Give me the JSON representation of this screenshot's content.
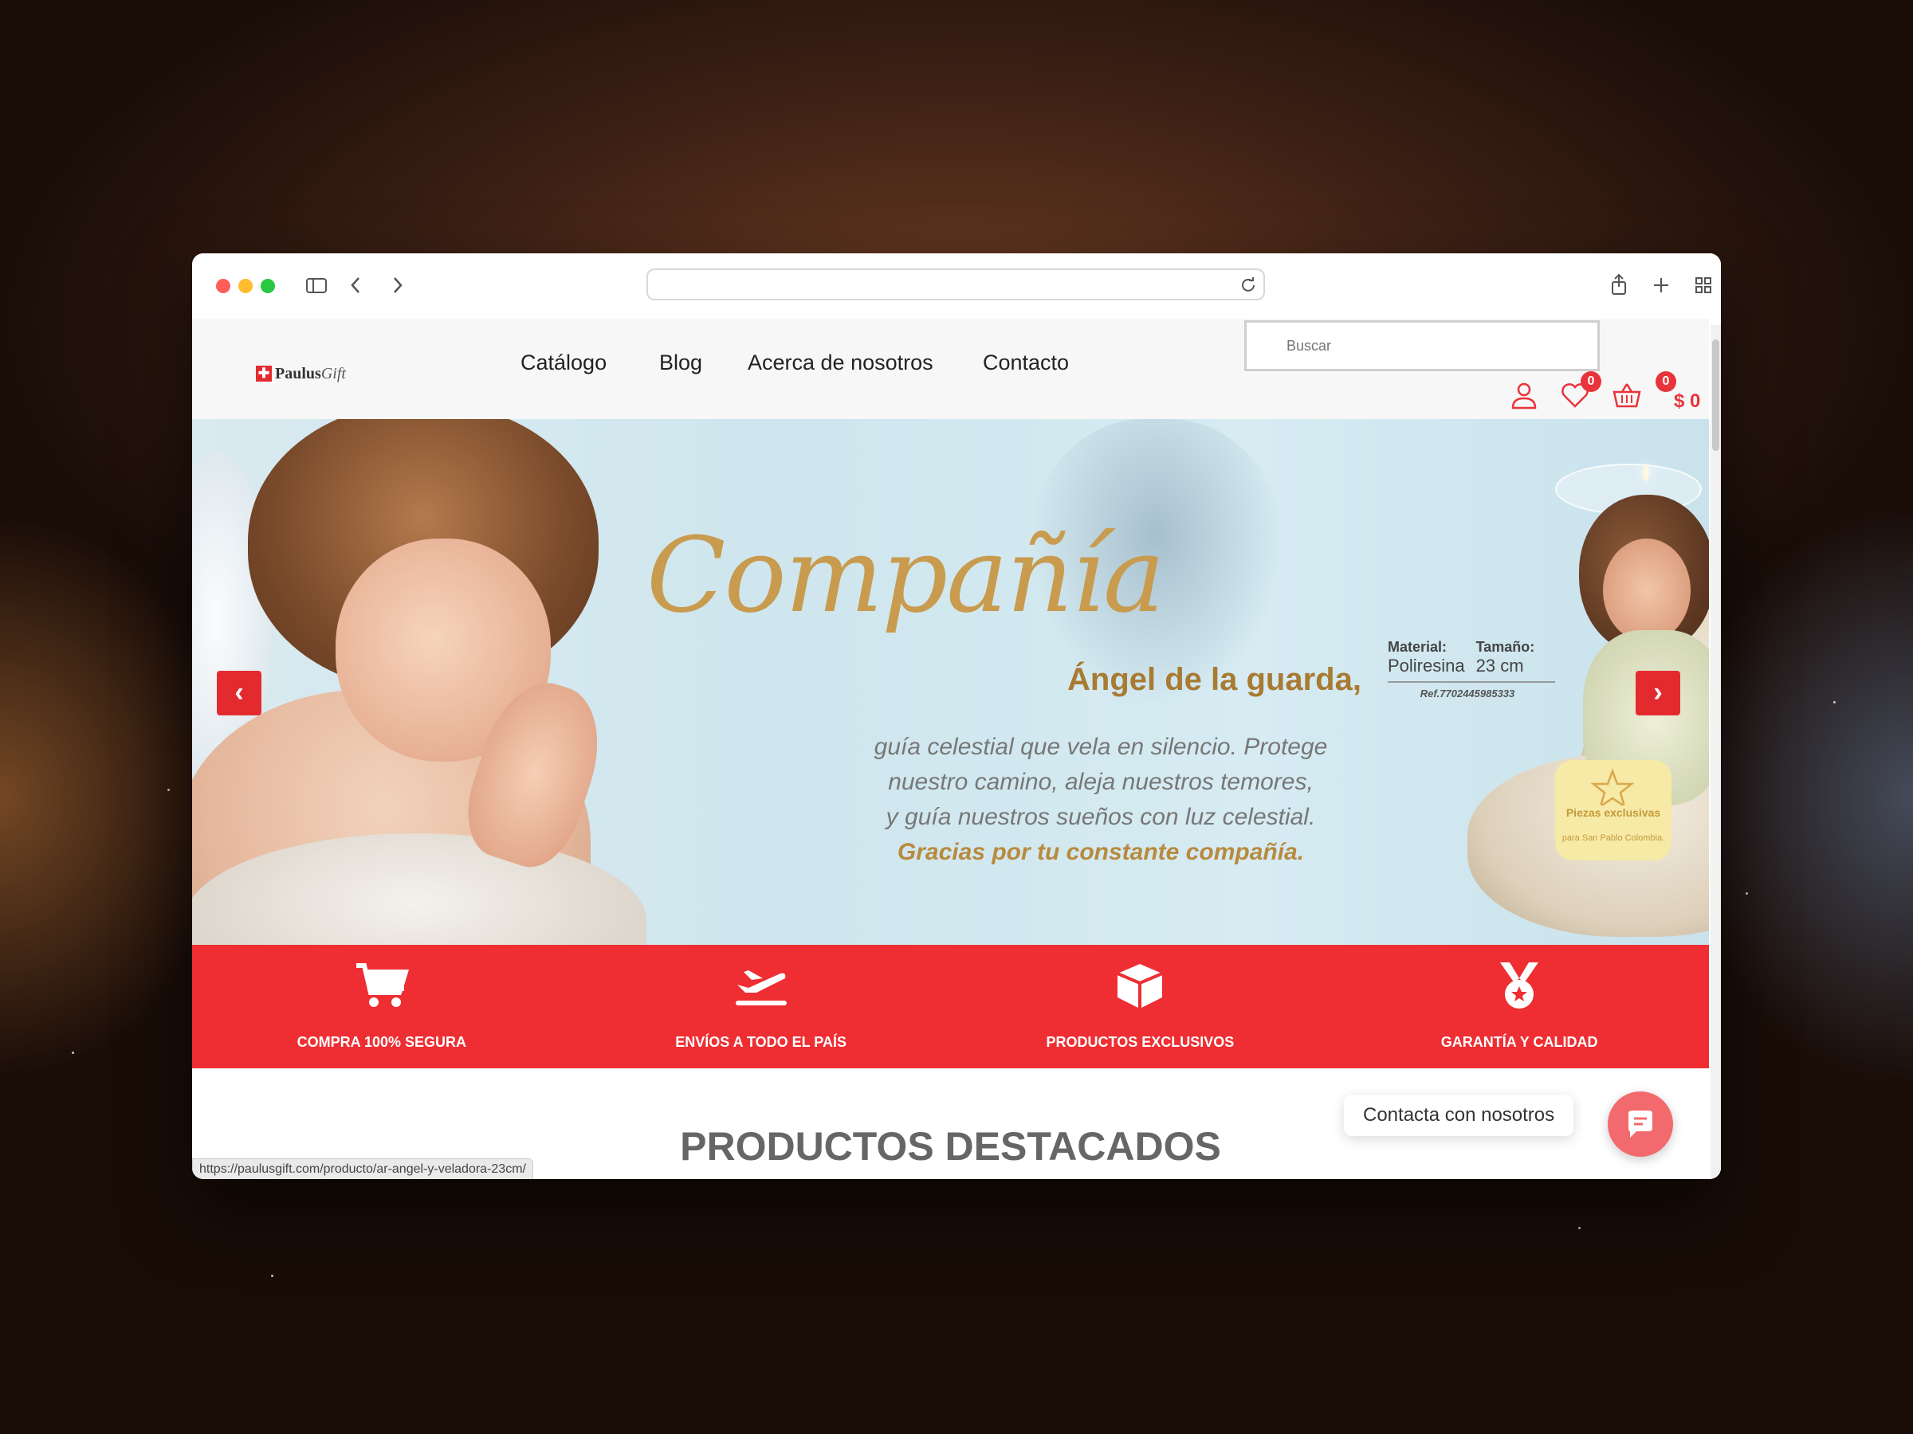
{
  "browser": {
    "url": ""
  },
  "site": {
    "logo_brand": "Paulus",
    "logo_brand_suffix": "Gift",
    "nav": [
      "Catálogo",
      "Blog",
      "Acerca de nosotros",
      "Contacto"
    ],
    "search_placeholder": "Buscar",
    "wishlist_count": "0",
    "cart_count": "0",
    "cart_total": "$ 0"
  },
  "hero": {
    "title": "Compañía",
    "subtitle": "Ángel de la guarda,",
    "body": [
      "guía celestial que vela en silencio. Protege",
      "nuestro camino, aleja nuestros temores,",
      "y guía nuestros sueños con luz celestial."
    ],
    "body_emphasis": "Gracias por tu constante compañía.",
    "spec_material_label": "Material:",
    "spec_material_value": "Poliresina",
    "spec_size_label": "Tamaño:",
    "spec_size_value": "23 cm",
    "spec_ref": "Ref.7702445985333",
    "seal_title": "Piezas exclusivas",
    "seal_small": "para San Pablo Colombia.",
    "prev_arrow": "‹",
    "next_arrow": "›"
  },
  "features": [
    {
      "label": "COMPRA 100% SEGURA",
      "icon": "cart-icon"
    },
    {
      "label": "ENVÍOS A TODO EL PAÍS",
      "icon": "airplane-icon"
    },
    {
      "label": "PRODUCTOS EXCLUSIVOS",
      "icon": "box-icon"
    },
    {
      "label": "GARANTÍA Y CALIDAD",
      "icon": "medal-icon"
    }
  ],
  "section_title": "PRODUCTOS DESTACADOS",
  "contact_label": "Contacta con nosotros",
  "status_url": "https://paulusgift.com/producto/ar-angel-y-veladora-23cm/",
  "colors": {
    "accent_red": "#ee2e33",
    "gold": "#c89b4f"
  }
}
